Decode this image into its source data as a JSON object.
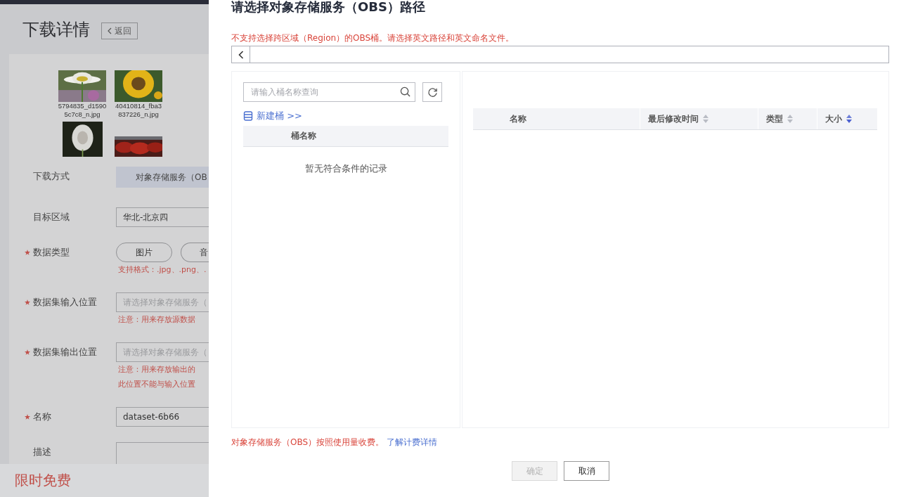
{
  "background_page": {
    "title": "下载详情",
    "back_button": "返回",
    "thumbnails": [
      {
        "caption_lines": [
          "5794835_d1590",
          "5c7c8_n.jpg"
        ],
        "kind": "picture"
      },
      {
        "caption_lines": [
          "40410814_fba3",
          "837226_n.jpg"
        ],
        "kind": "picture"
      },
      {
        "kind": "picture"
      },
      {
        "kind": "picture"
      }
    ],
    "form_rows": [
      {
        "label": "下载方式",
        "required": false,
        "kind": "tab",
        "value": "对象存储服务（OB"
      },
      {
        "label": "目标区域",
        "required": false,
        "kind": "input",
        "value": "华北-北京四"
      },
      {
        "label": "数据类型",
        "required": true,
        "kind": "options",
        "options": [
          {
            "label": "图片",
            "selected": false
          },
          {
            "label": "音",
            "selected": false
          }
        ],
        "hints": [
          "支持格式：.jpg、.png、."
        ]
      },
      {
        "label": "数据集输入位置",
        "required": true,
        "kind": "input",
        "placeholder": "请选择对象存储服务（",
        "hints": [
          "注意：用来存放源数据"
        ]
      },
      {
        "label": "数据集输出位置",
        "required": true,
        "kind": "input",
        "placeholder": "请选择对象存储服务（",
        "hints": [
          "注意：用来存放输出的",
          "此位置不能与输入位置"
        ]
      },
      {
        "label": "名称",
        "required": true,
        "kind": "input",
        "value": "dataset-6b66"
      },
      {
        "label": "描述",
        "required": false,
        "kind": "textarea"
      }
    ],
    "promo": "限时免费"
  },
  "dialog": {
    "title": "请选择对象存储服务（OBS）路径",
    "warning": "不支持选择跨区域（Region）的OBS桶。请选择英文路径和英文命名文件。",
    "bucket_search": {
      "placeholder": "请输入桶名称查询"
    },
    "new_bucket_link": "新建桶 >>",
    "bucket_table": {
      "columns": [
        {
          "label": "桶名称"
        }
      ],
      "empty_text": "暂无符合条件的记录"
    },
    "file_table": {
      "columns": [
        {
          "label": "名称"
        },
        {
          "label": "最后修改时间",
          "sortable": true,
          "sorted": false
        },
        {
          "label": "类型",
          "sortable": true,
          "sorted": false
        },
        {
          "label": "大小",
          "sortable": true,
          "sorted": true
        }
      ]
    },
    "billing_note": "对象存储服务（OBS）按照使用量收费。",
    "billing_link": "了解计费详情",
    "buttons": [
      {
        "label": "确定",
        "disabled": true
      },
      {
        "label": "取消",
        "disabled": false
      }
    ]
  }
}
